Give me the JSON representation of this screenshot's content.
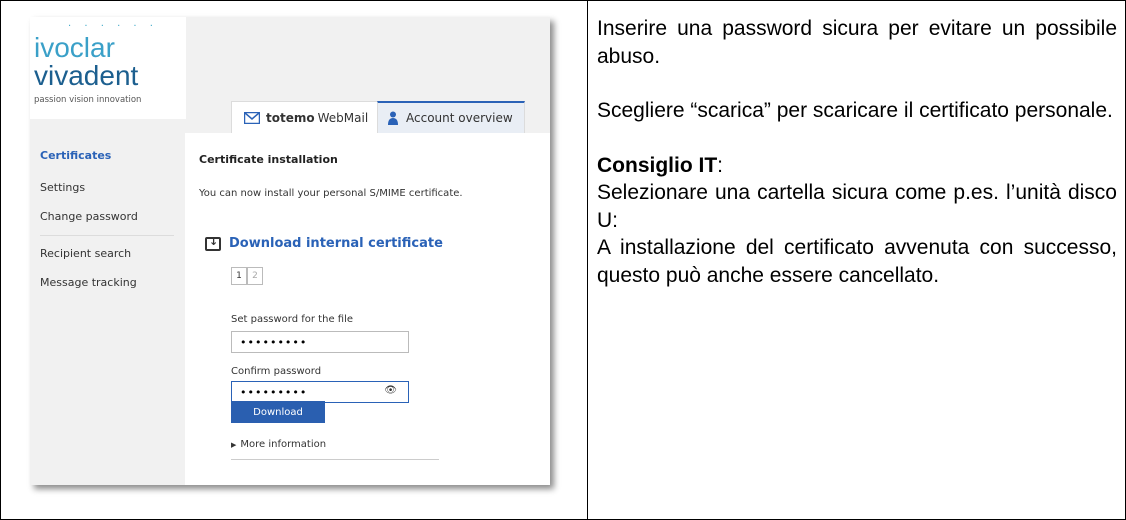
{
  "logo": {
    "line1": "ivoclar",
    "line2": "vivadent",
    "tagline": "passion vision innovation"
  },
  "tabs": [
    {
      "brand": "totemo",
      "label": "WebMail",
      "icon": "envelope-icon"
    },
    {
      "label": "Account overview",
      "icon": "person-icon"
    }
  ],
  "sidebar": {
    "items": [
      {
        "label": "Certificates"
      },
      {
        "label": "Settings"
      },
      {
        "label": "Change password"
      },
      {
        "label": "Recipient search"
      },
      {
        "label": "Message tracking"
      }
    ]
  },
  "content": {
    "title": "Certificate installation",
    "description": "You can now install your personal S/MIME certificate.",
    "download_heading": "Download internal certificate",
    "steps": [
      "1",
      "2"
    ],
    "password_label": "Set password for the file",
    "password_value": "•••••••••",
    "confirm_label": "Confirm password",
    "confirm_value": "•••••••••",
    "download_button": "Download",
    "more_info": "More information"
  },
  "instructions": {
    "para1": "Inserire una password sicura per evitare un possibile abuso.",
    "para2": "Scegliere “scarica” per scaricare il certificato personale.",
    "tip_title": "Consiglio IT",
    "tip_colon": ":",
    "tip_line1": "Selezionare una cartella sicura come p.es. l’unità disco U:",
    "tip_line2": "A installazione del certificato avvenuta con successo, questo può anche essere cancellato."
  },
  "colors": {
    "accent": "#2a62b7",
    "logo_light": "#3aa0c8",
    "logo_dark": "#1c5f8f"
  }
}
